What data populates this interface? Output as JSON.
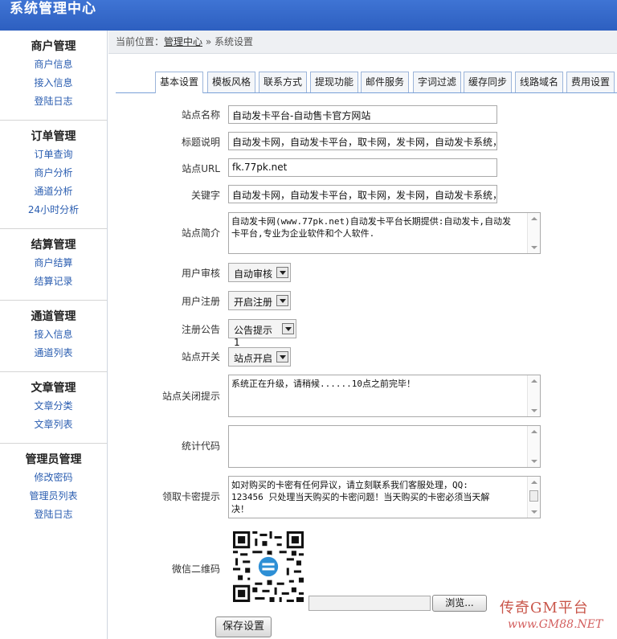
{
  "header": {
    "title": "系统管理中心"
  },
  "sidebar": {
    "groups": [
      {
        "title": "商户管理",
        "items": [
          "商户信息",
          "接入信息",
          "登陆日志"
        ]
      },
      {
        "title": "订单管理",
        "items": [
          "订单查询",
          "商户分析",
          "通道分析",
          "24小时分析"
        ]
      },
      {
        "title": "结算管理",
        "items": [
          "商户结算",
          "结算记录"
        ]
      },
      {
        "title": "通道管理",
        "items": [
          "接入信息",
          "通道列表"
        ]
      },
      {
        "title": "文章管理",
        "items": [
          "文章分类",
          "文章列表"
        ]
      },
      {
        "title": "管理员管理",
        "items": [
          "修改密码",
          "管理员列表",
          "登陆日志"
        ]
      }
    ]
  },
  "breadcrumb": {
    "prefix": "当前位置：",
    "link": "管理中心",
    "separator": " » ",
    "current": "系统设置"
  },
  "tabs": [
    "基本设置",
    "模板风格",
    "联系方式",
    "提现功能",
    "邮件服务",
    "字词过滤",
    "缓存同步",
    "线路域名",
    "费用设置"
  ],
  "form": {
    "site_name": {
      "label": "站点名称",
      "value": "自动发卡平台-自动售卡官方网站"
    },
    "site_title": {
      "label": "标题说明",
      "value": "自动发卡网，自动发卡平台，取卡网，发卡网，自动发卡系统，"
    },
    "site_url": {
      "label": "站点URL",
      "value": "fk.77pk.net"
    },
    "keywords": {
      "label": "关键字",
      "value": "自动发卡网，自动发卡平台，取卡网，发卡网，自动发卡系统，"
    },
    "description": {
      "label": "站点简介",
      "line1": "自动发卡网(www.77pk.net)自动发卡平台长期提供:自动发卡,自动发",
      "line2": "卡平台,专业为企业软件和个人软件."
    },
    "user_review": {
      "label": "用户审核",
      "value": "自动审核"
    },
    "user_register": {
      "label": "用户注册",
      "value": "开启注册"
    },
    "register_notice": {
      "label": "注册公告",
      "value": "公告提示1"
    },
    "site_switch": {
      "label": "站点开关",
      "value": "站点开启"
    },
    "close_notice": {
      "label": "站点关闭提示",
      "value": "系统正在升级，请稍候......10点之前完毕！"
    },
    "stats_code": {
      "label": "统计代码",
      "value": ""
    },
    "card_notice": {
      "label": "领取卡密提示",
      "line1": "如对购买的卡密有任何异议，请立刻联系我们客服处理，QQ:",
      "line2": "123456 只处理当天购买的卡密问题！当天购买的卡密必须当天解",
      "line3": "决！"
    },
    "wechat_qr": {
      "label": "微信二维码",
      "browse_label": "浏览..."
    },
    "save_label": "保存设置"
  },
  "watermark": {
    "line1": "传奇GM平台",
    "line2": "www.GM88.NET"
  }
}
